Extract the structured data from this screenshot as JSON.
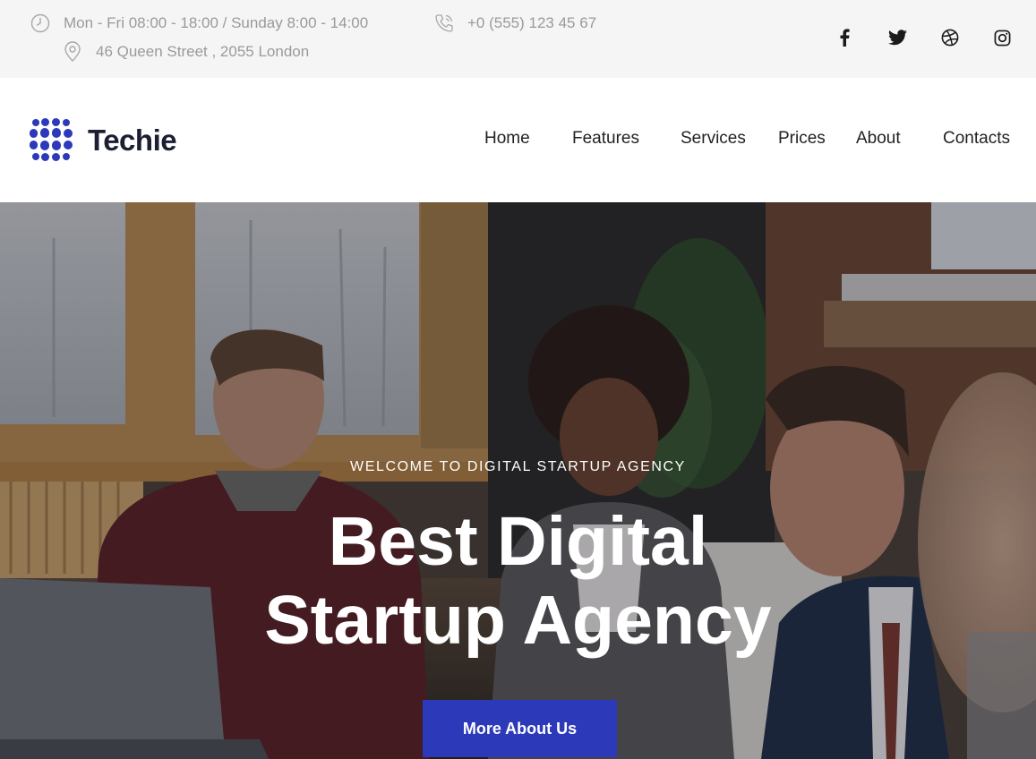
{
  "topbar": {
    "hours": "Mon - Fri 08:00 - 18:00 / Sunday 8:00 - 14:00",
    "address": "46 Queen Street , 2055 London",
    "phone": "+0 (555) 123 45 67",
    "hours_icon": "clock-icon",
    "address_icon": "map-pin-icon",
    "phone_icon": "phone-icon",
    "social": [
      "facebook-icon",
      "twitter-icon",
      "dribbble-icon",
      "instagram-icon"
    ]
  },
  "header": {
    "brand": "Techie",
    "logo_icon": "dot-grid-logo-icon",
    "nav": [
      "Home",
      "Features",
      "Services",
      "Prices",
      "About",
      "Contacts"
    ]
  },
  "hero": {
    "kicker": "WELCOME TO DIGITAL STARTUP AGENCY",
    "headline_line1": "Best Digital",
    "headline_line2": "Startup Agency",
    "cta_label": "More About Us"
  },
  "colors": {
    "accent": "#2c39b8",
    "topbar_bg": "#f5f5f5",
    "topbar_text": "#9a9a9a",
    "brand_text": "#1c1f33"
  }
}
